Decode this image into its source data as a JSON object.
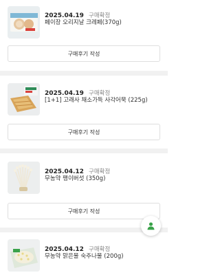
{
  "orders": [
    {
      "date": "2025.04.19",
      "status": "구매확정",
      "product_name": "페이장 오리지날 크레페(370g)",
      "review_button_label": "구매후기 작성",
      "thumbnail_icon": "crepe-package-image"
    },
    {
      "date": "2025.04.19",
      "status": "구매확정",
      "product_name": "[1+1] 고래사 채소가득 사각어묵 (225g)",
      "review_button_label": "구매후기 작성",
      "thumbnail_icon": "fish-cake-image"
    },
    {
      "date": "2025.04.12",
      "status": "구매확정",
      "product_name": "무농약 팽이버섯 (350g)",
      "review_button_label": "구매후기 작성",
      "thumbnail_icon": "enoki-mushroom-image"
    },
    {
      "date": "2025.04.12",
      "status": "구매확정",
      "product_name": "무농약 맑은물 숙주나물 (200g)",
      "thumbnail_icon": "bean-sprouts-image"
    }
  ],
  "floating_button": {
    "icon": "user-icon",
    "accent_color": "#3aa24a"
  }
}
